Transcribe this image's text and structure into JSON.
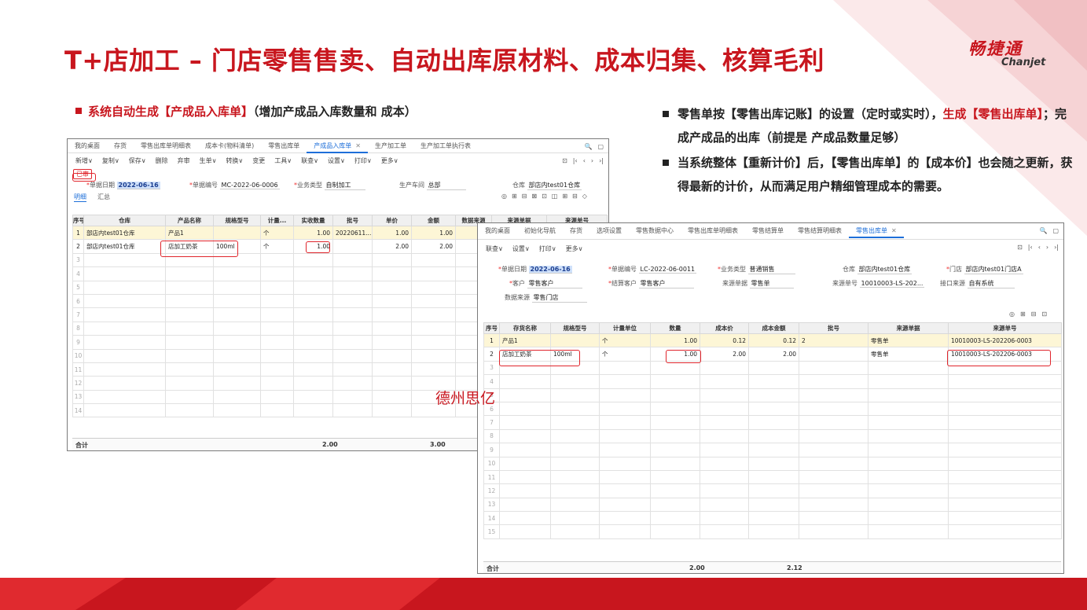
{
  "title": "T+店加工  – 门店零售售卖、自动出库原材料、成本归集、核算毛利",
  "logo": {
    "cn": "畅捷通",
    "en": "Chanjet"
  },
  "left_heading": {
    "prefix": "系统自动生成",
    "highlight": "【产成品入库单】",
    "suffix": "（增加产成品入库数量和 成本）"
  },
  "notes": [
    {
      "part1": "零售单按【零售出库记账】的设置（定时或实时），",
      "part2": "生成【零售出库单】",
      "part3": "；完成产成品的出库（前提是 产成品数量足够）"
    },
    {
      "part1": "当系统整体【重新计价】后，【零售出库单】的【成本价】也会随之更新，获得最新的计价，从而满足用户精细管理成本的需要。"
    }
  ],
  "watermark": "德州思亿",
  "colors": {
    "brand_red": "#c8161e",
    "active_tab": "#1e6fd9"
  },
  "win1": {
    "tabs": [
      "我的桌面",
      "存货",
      "零售出库单明细表",
      "成本卡(物料清单)",
      "零售出库单",
      "产成品入库单",
      "生产加工单",
      "生产加工单执行表"
    ],
    "active_tab": "产成品入库单",
    "toolbar": [
      "新增∨",
      "复制∨",
      "保存∨",
      "删除",
      "弃审",
      "生单∨",
      "转换∨",
      "变更",
      "工具∨",
      "联查∨",
      "设置∨",
      "打印∨",
      "更多∨"
    ],
    "badge": "已审",
    "fields": {
      "date_label": "单据日期",
      "date": "2022-06-16",
      "code_label": "单据编号",
      "code": "MC-2022-06-0006",
      "biz_label": "业务类型",
      "biz": "自制加工",
      "ws_label": "生产车间",
      "ws": "总部",
      "wh_label": "仓库",
      "wh": "部店内test01仓库"
    },
    "subtabs": [
      "明细",
      "汇总"
    ],
    "columns": [
      "序号",
      "仓库",
      "产品名称",
      "规格型号",
      "计量...",
      "实收数量",
      "批号",
      "单价",
      "金额",
      "数据来源",
      "来源单据",
      "来源单号"
    ],
    "rows": [
      [
        "1",
        "部店内test01仓库",
        "产品1",
        "",
        "个",
        "1.00",
        "20220611...",
        "1.00",
        "1.00",
        "",
        "",
        ""
      ],
      [
        "2",
        "部店内test01仓库",
        "店加工奶茶",
        "100ml",
        "个",
        "1.00",
        "",
        "2.00",
        "2.00",
        "",
        "",
        ""
      ]
    ],
    "empty_rows": [
      "3",
      "4",
      "5",
      "6",
      "7",
      "8",
      "9",
      "10",
      "11",
      "12",
      "13",
      "14"
    ],
    "total_label": "合计",
    "total_qty": "2.00",
    "total_amount": "3.00"
  },
  "win2": {
    "tabs": [
      "我的桌面",
      "初始化导航",
      "存货",
      "选项设置",
      "零售数据中心",
      "零售出库单明细表",
      "零售结算单",
      "零售结算明细表",
      "零售出库单"
    ],
    "active_tab": "零售出库单",
    "toolbar": [
      "联查∨",
      "设置∨",
      "打印∨",
      "更多∨"
    ],
    "fields": {
      "date_label": "单据日期",
      "date": "2022-06-16",
      "code_label": "单据编号",
      "code": "LC-2022-06-0011",
      "biz_label": "业务类型",
      "biz": "普通销售",
      "wh_label": "仓库",
      "wh": "部店内test01仓库",
      "store_label": "门店",
      "store": "部店内test01门店A",
      "cust_label": "客户",
      "cust": "零售客户",
      "settle_label": "结算客户",
      "settle": "零售客户",
      "srctype_label": "来源单据",
      "srctype": "零售单",
      "srccode_label": "来源单号",
      "srccode": "10010003-LS-202...",
      "iface_label": "接口来源",
      "iface": "自有系统",
      "chan_label": "数据来源",
      "chan": "零售门店"
    },
    "columns": [
      "序号",
      "存货名称",
      "规格型号",
      "计量单位",
      "数量",
      "成本价",
      "成本金额",
      "批号",
      "来源单据",
      "来源单号"
    ],
    "rows": [
      [
        "1",
        "产品1",
        "",
        "个",
        "1.00",
        "0.12",
        "0.12",
        "2",
        "零售单",
        "10010003-LS-202206-0003"
      ],
      [
        "2",
        "店加工奶茶",
        "100ml",
        "个",
        "1.00",
        "2.00",
        "2.00",
        "",
        "零售单",
        "10010003-LS-202206-0003"
      ]
    ],
    "empty_rows": [
      "3",
      "4",
      "5",
      "6",
      "7",
      "8",
      "9",
      "10",
      "11",
      "12",
      "13",
      "14",
      "15"
    ],
    "total_label": "合计",
    "total_qty": "2.00",
    "total_amount": "2.12"
  }
}
